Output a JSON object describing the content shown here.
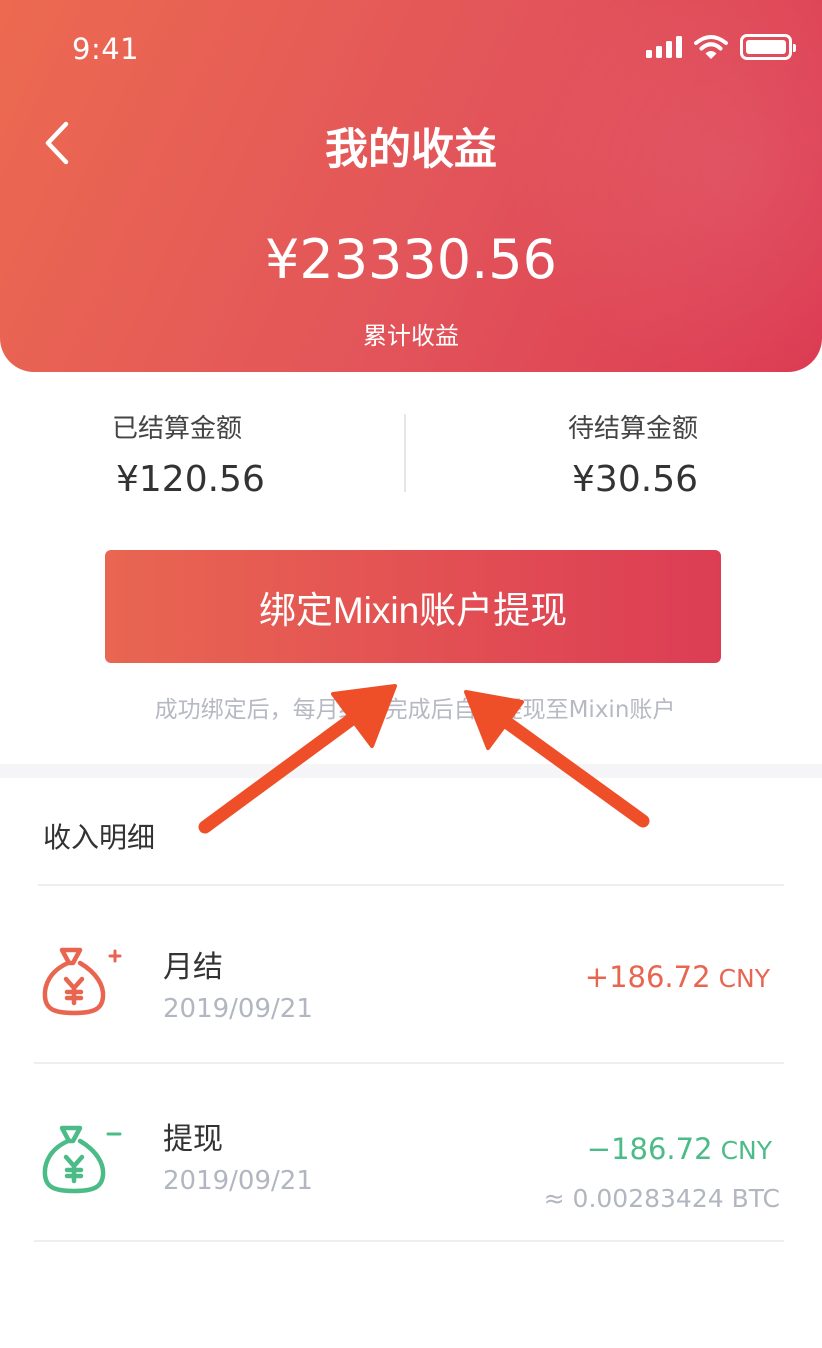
{
  "status_bar": {
    "time": "9:41"
  },
  "header": {
    "title": "我的收益",
    "total_amount": "¥23330.56",
    "total_label": "累计收益"
  },
  "stats": {
    "settled": {
      "label": "已结算金额",
      "value": "¥120.56"
    },
    "pending": {
      "label": "待结算金额",
      "value": "¥30.56"
    }
  },
  "withdraw": {
    "button_label": "绑定Mixin账户提现",
    "hint": "成功绑定后，每月结算完成后自动提现至Mixin账户"
  },
  "income": {
    "section_title": "收入明细",
    "items": [
      {
        "name": "月结",
        "date": "2019/09/21",
        "amount": "+186.72",
        "unit": "CNY",
        "sub": "",
        "type": "income"
      },
      {
        "name": "提现",
        "date": "2019/09/21",
        "amount": "−186.72",
        "unit": "CNY",
        "sub": "≈ 0.00283424 BTC",
        "type": "withdraw"
      }
    ]
  },
  "colors": {
    "header_start": "#ec6a50",
    "header_end": "#dc3a52",
    "income": "#e86550",
    "withdraw": "#4bbc87",
    "annotation_arrow": "#ee4f28"
  },
  "icons": {
    "back": "chevron-left-icon",
    "income": "money-bag-plus-icon",
    "withdraw": "money-bag-minus-icon",
    "annotation": "red-arrow-annotation"
  }
}
